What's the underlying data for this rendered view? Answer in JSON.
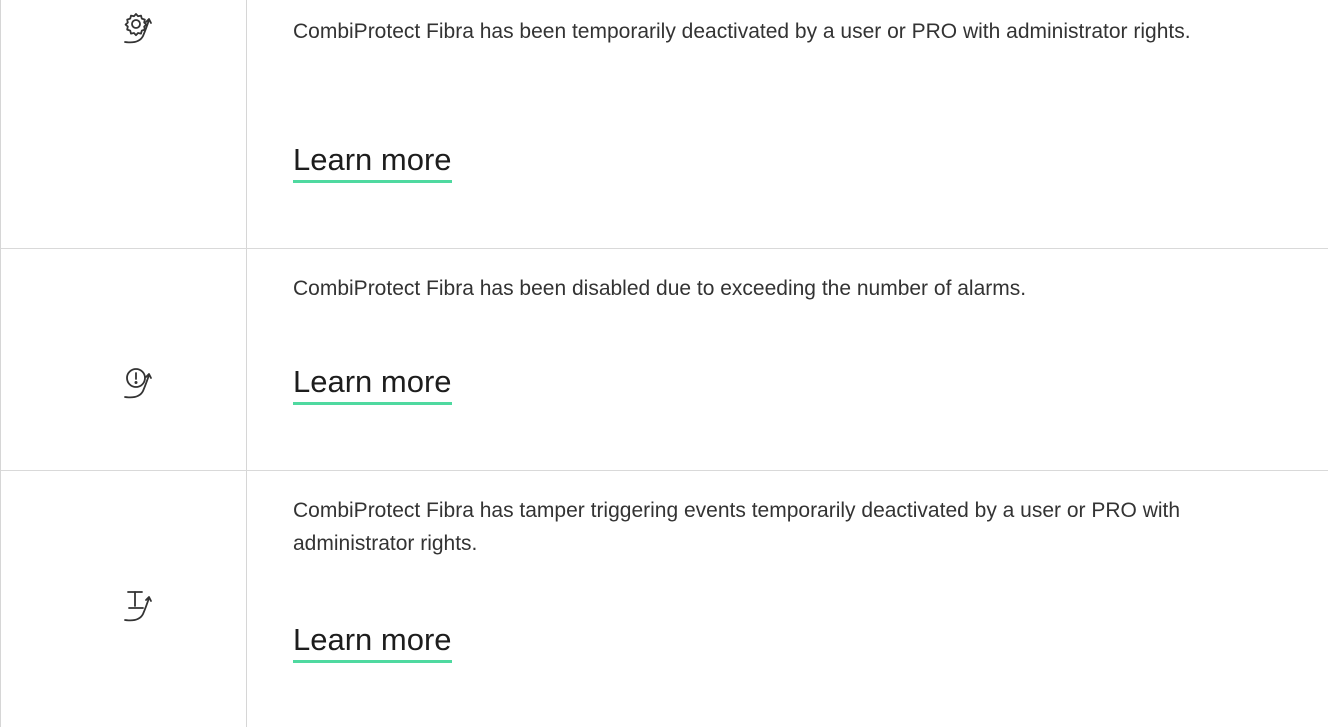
{
  "rows": [
    {
      "icon": "gear-deactivated-icon",
      "description": "CombiProtect Fibra has been temporarily deactivated by a user or PRO with administrator rights.",
      "link_label": "Learn more"
    },
    {
      "icon": "exclamation-disabled-icon",
      "description": "CombiProtect Fibra has been disabled due to exceeding the number of alarms.",
      "link_label": "Learn more"
    },
    {
      "icon": "tamper-deactivated-icon",
      "description": "CombiProtect Fibra has tamper triggering events temporarily deactivated by a user or PRO with administrator rights.",
      "link_label": "Learn more"
    }
  ],
  "colors": {
    "link_underline": "#4fd9a0",
    "border": "#d6d6d6",
    "text": "#333333"
  }
}
